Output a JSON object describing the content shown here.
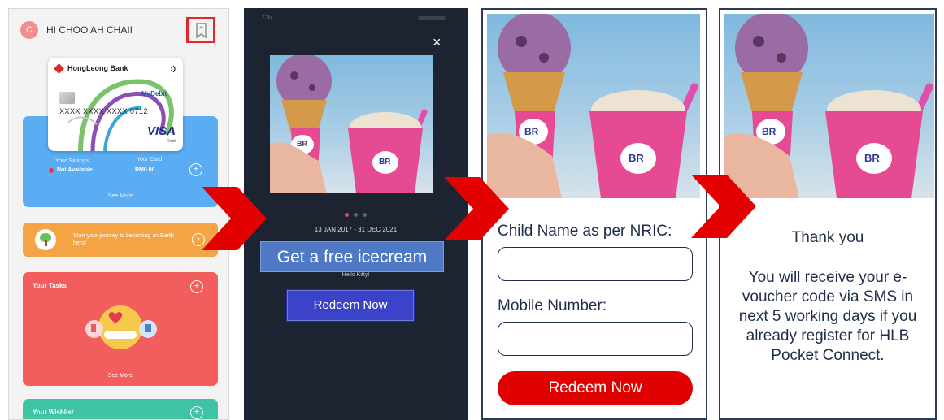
{
  "panel1": {
    "avatar_initial": "C",
    "greeting": "HI CHOO AH CHAII",
    "card": {
      "bank": "HongLeong Bank",
      "number": "XXXX XXXX XXXX 0712",
      "network": "VISA",
      "tag": "MyDebit",
      "debit": "Debit"
    },
    "savings": {
      "savings_label": "Your Savings",
      "savings_value": "Not Available",
      "card_label": "Your Card",
      "card_value": "RM0.00",
      "see_more": "See More"
    },
    "earth_text": "Start your journey to becoming an Earth hero!",
    "tasks": {
      "title": "Your Tasks",
      "see_more": "See More"
    },
    "wishlist_title": "Your Wishlist",
    "add": "+",
    "go": "›"
  },
  "panel2": {
    "time": "7:57",
    "close": "×",
    "date_range": "13 JAN 2017 - 31 DEC 2021",
    "headline": "Get a free icecream",
    "subtext": "Hello Kitty!",
    "redeem": "Redeem Now",
    "brand": "BR"
  },
  "panel3": {
    "child_label": "Child Name as per NRIC:",
    "child_value": "",
    "mobile_label": "Mobile Number:",
    "mobile_value": "",
    "redeem": "Redeem Now"
  },
  "panel4": {
    "thanks": "Thank you",
    "message": "You will receive your e-voucher code via SMS in next 5 working days if you already register for HLB Pocket Connect."
  },
  "colors": {
    "arrow": "#e30000",
    "highlight": "#e3262b",
    "savings": "#5aacf3",
    "earth": "#f4a345",
    "tasks": "#f25d5d",
    "wishlist": "#3ec3a4",
    "app_dark": "#1d2431",
    "banner": "#4f79c4",
    "redeem_blue": "#3b44c9",
    "redeem_red": "#e00000",
    "text_navy": "#1c2c4a"
  },
  "icons": [
    "bookmark-icon",
    "close-icon",
    "plus-circle-icon",
    "chevron-right-icon",
    "tree-icon",
    "contactless-icon",
    "chip-icon",
    "ice-cream-illustration"
  ]
}
